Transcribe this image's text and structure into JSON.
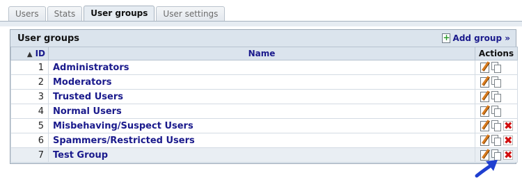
{
  "tabs": [
    {
      "label": "Users",
      "active": false
    },
    {
      "label": "Stats",
      "active": false
    },
    {
      "label": "User groups",
      "active": true
    },
    {
      "label": "User settings",
      "active": false
    }
  ],
  "panel": {
    "title": "User groups",
    "add_group_label": "Add group »"
  },
  "table": {
    "headers": {
      "id": "ID",
      "name": "Name",
      "actions": "Actions"
    },
    "rows": [
      {
        "id": "1",
        "name": "Administrators",
        "can_delete": false
      },
      {
        "id": "2",
        "name": "Moderators",
        "can_delete": false
      },
      {
        "id": "3",
        "name": "Trusted Users",
        "can_delete": false
      },
      {
        "id": "4",
        "name": "Normal Users",
        "can_delete": false
      },
      {
        "id": "5",
        "name": "Misbehaving/Suspect Users",
        "can_delete": true
      },
      {
        "id": "6",
        "name": "Spammers/Restricted Users",
        "can_delete": true
      },
      {
        "id": "7",
        "name": "Test Group",
        "can_delete": true
      }
    ]
  },
  "icons": {
    "sort": "sort-ascending-icon",
    "add": "add-page-icon",
    "edit": "edit-icon",
    "copy": "copy-icon",
    "delete": "delete-icon",
    "annotation": "blue-arrow-icon"
  },
  "colors": {
    "link": "#1a1a8c",
    "panel_bg": "#dbe4ed",
    "delete": "#d11010",
    "arrow": "#1f3fd0"
  }
}
